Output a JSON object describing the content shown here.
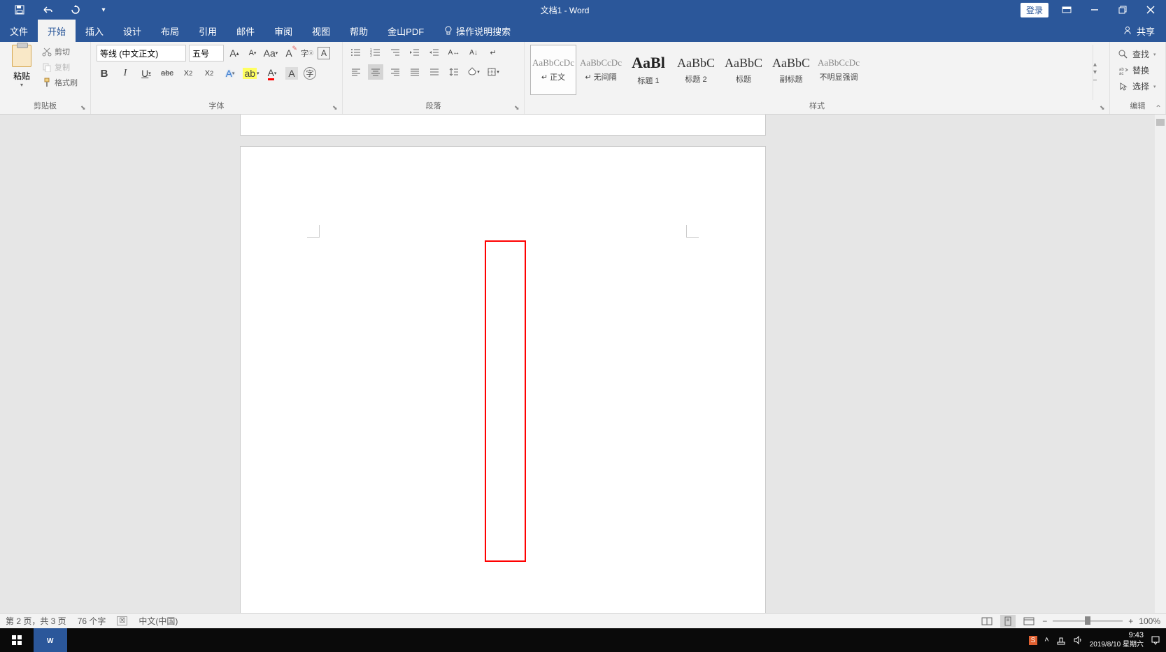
{
  "titleBar": {
    "docTitle": "文档1 - Word",
    "login": "登录"
  },
  "menu": {
    "file": "文件",
    "home": "开始",
    "insert": "插入",
    "design": "设计",
    "layout": "布局",
    "references": "引用",
    "mailings": "邮件",
    "review": "审阅",
    "view": "视图",
    "help": "帮助",
    "jinshan": "金山PDF",
    "tellme": "操作说明搜索",
    "share": "共享"
  },
  "ribbon": {
    "clipboard": {
      "paste": "粘贴",
      "cut": "剪切",
      "copy": "复制",
      "formatPainter": "格式刷",
      "groupLabel": "剪贴板"
    },
    "font": {
      "fontName": "等线 (中文正文)",
      "fontSize": "五号",
      "groupLabel": "字体"
    },
    "paragraph": {
      "groupLabel": "段落"
    },
    "styles": {
      "groupLabel": "样式",
      "items": [
        {
          "preview": "AaBbCcDc",
          "label": "↵ 正文",
          "cls": "normal"
        },
        {
          "preview": "AaBbCcDc",
          "label": "↵ 无间隔",
          "cls": "normal"
        },
        {
          "preview": "AaBl",
          "label": "标题 1",
          "cls": "big"
        },
        {
          "preview": "AaBbC",
          "label": "标题 2",
          "cls": "med"
        },
        {
          "preview": "AaBbC",
          "label": "标题",
          "cls": "med"
        },
        {
          "preview": "AaBbC",
          "label": "副标题",
          "cls": "med"
        },
        {
          "preview": "AaBbCcDc",
          "label": "不明显强调",
          "cls": "normal"
        }
      ]
    },
    "editing": {
      "find": "查找",
      "replace": "替换",
      "select": "选择",
      "groupLabel": "编辑"
    }
  },
  "statusBar": {
    "pageInfo": "第 2 页，共 3 页",
    "wordCount": "76 个字",
    "language": "中文(中国)",
    "zoom": "100%"
  },
  "taskbar": {
    "time": "9:43",
    "date": "2019/8/10 星期六"
  }
}
